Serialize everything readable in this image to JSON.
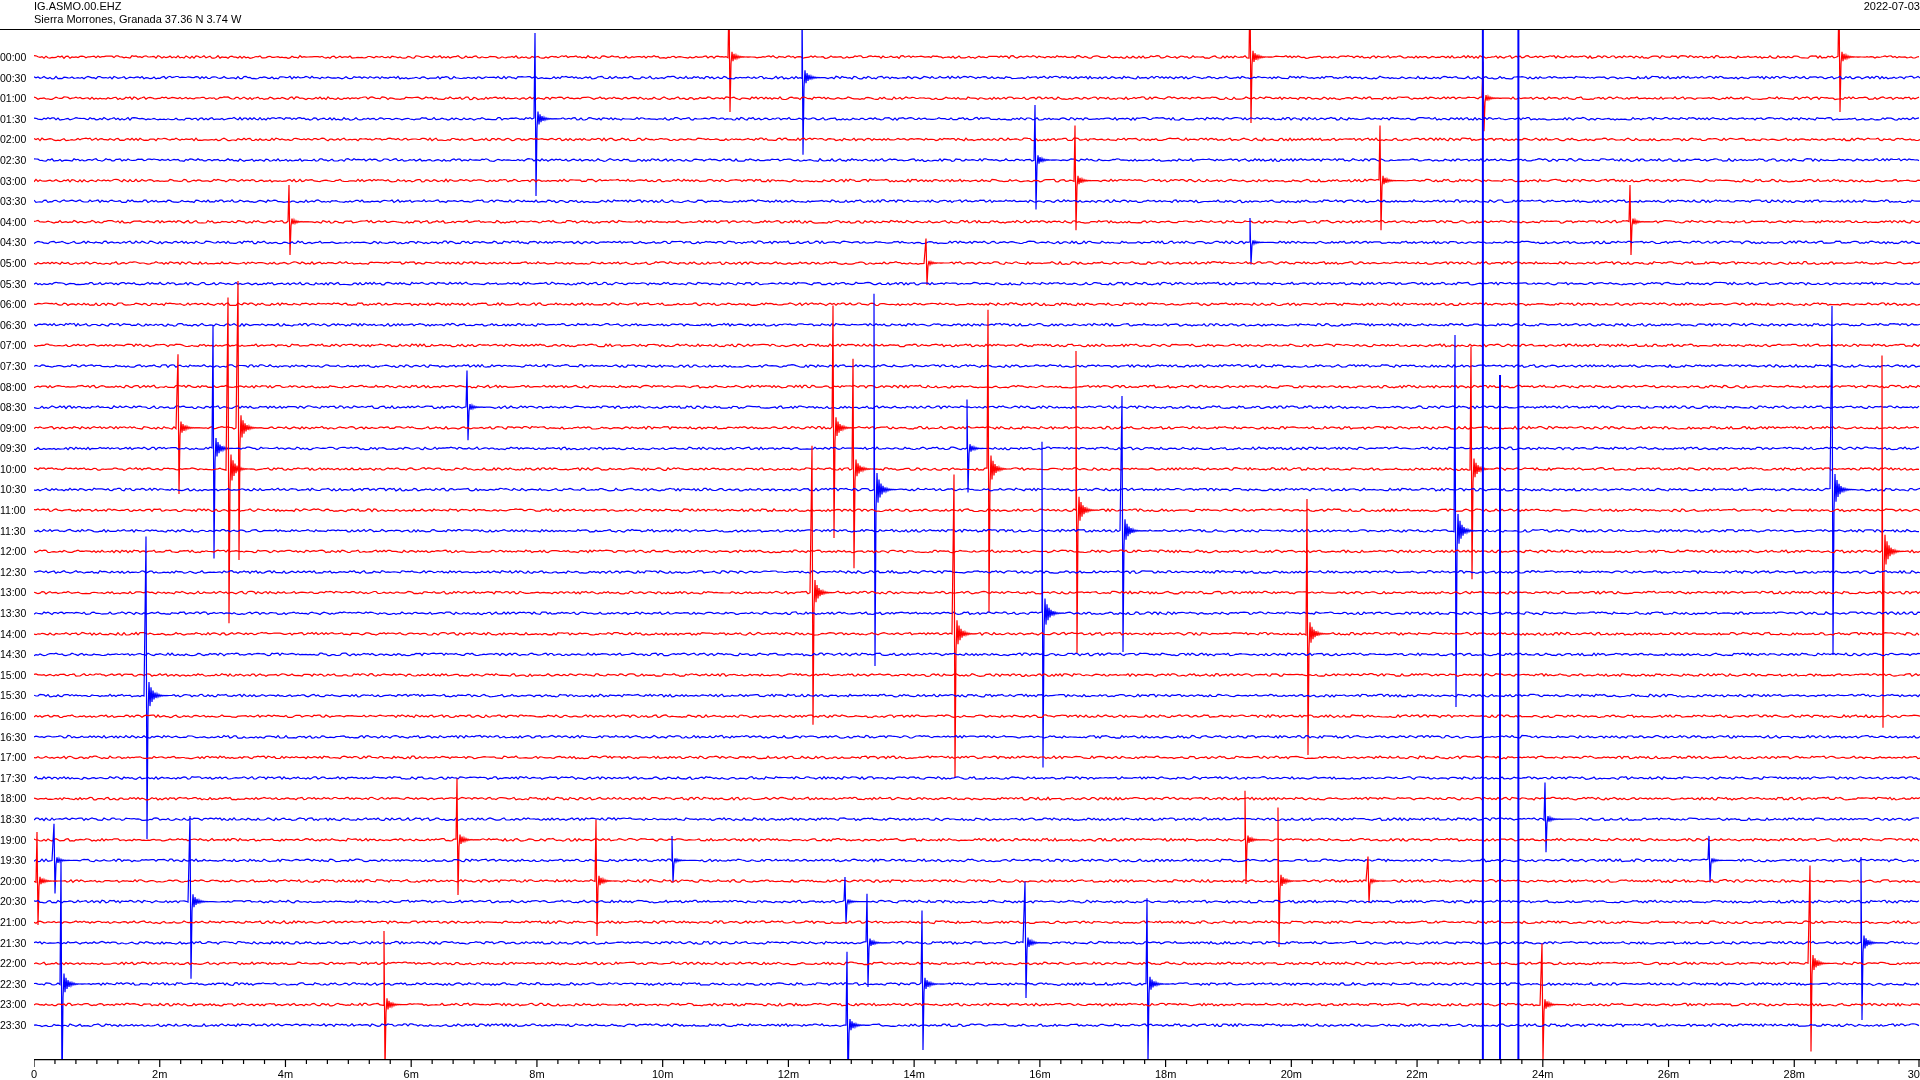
{
  "header": {
    "station": "IG.ASMO.00.EHZ",
    "location": "Sierra Morrones, Granada  37.36 N 3.74 W",
    "date": "2022-07-03"
  },
  "traces": [
    {
      "time": "00:00"
    },
    {
      "time": "00:30"
    },
    {
      "time": "01:00"
    },
    {
      "time": "01:30"
    },
    {
      "time": "02:00"
    },
    {
      "time": "02:30"
    },
    {
      "time": "03:00"
    },
    {
      "time": "03:30"
    },
    {
      "time": "04:00"
    },
    {
      "time": "04:30"
    },
    {
      "time": "05:00"
    },
    {
      "time": "05:30"
    },
    {
      "time": "06:00"
    },
    {
      "time": "06:30"
    },
    {
      "time": "07:00"
    },
    {
      "time": "07:30"
    },
    {
      "time": "08:00"
    },
    {
      "time": "08:30"
    },
    {
      "time": "09:00"
    },
    {
      "time": "09:30"
    },
    {
      "time": "10:00"
    },
    {
      "time": "10:30"
    },
    {
      "time": "11:00"
    },
    {
      "time": "11:30"
    },
    {
      "time": "12:00"
    },
    {
      "time": "12:30"
    },
    {
      "time": "13:00"
    },
    {
      "time": "13:30"
    },
    {
      "time": "14:00"
    },
    {
      "time": "14:30"
    },
    {
      "time": "15:00"
    },
    {
      "time": "15:30"
    },
    {
      "time": "16:00"
    },
    {
      "time": "16:30"
    },
    {
      "time": "17:00"
    },
    {
      "time": "17:30"
    },
    {
      "time": "18:00"
    },
    {
      "time": "18:30"
    },
    {
      "time": "19:00"
    },
    {
      "time": "19:30"
    },
    {
      "time": "20:00"
    },
    {
      "time": "20:30"
    },
    {
      "time": "21:00"
    },
    {
      "time": "21:30"
    },
    {
      "time": "22:00"
    },
    {
      "time": "22:30"
    },
    {
      "time": "23:00"
    },
    {
      "time": "23:30"
    }
  ],
  "x_axis": {
    "labels": [
      "0",
      "2m",
      "4m",
      "6m",
      "8m",
      "10m",
      "12m",
      "14m",
      "16m",
      "18m",
      "20m",
      "22m",
      "24m",
      "26m",
      "28m",
      "30"
    ]
  }
}
